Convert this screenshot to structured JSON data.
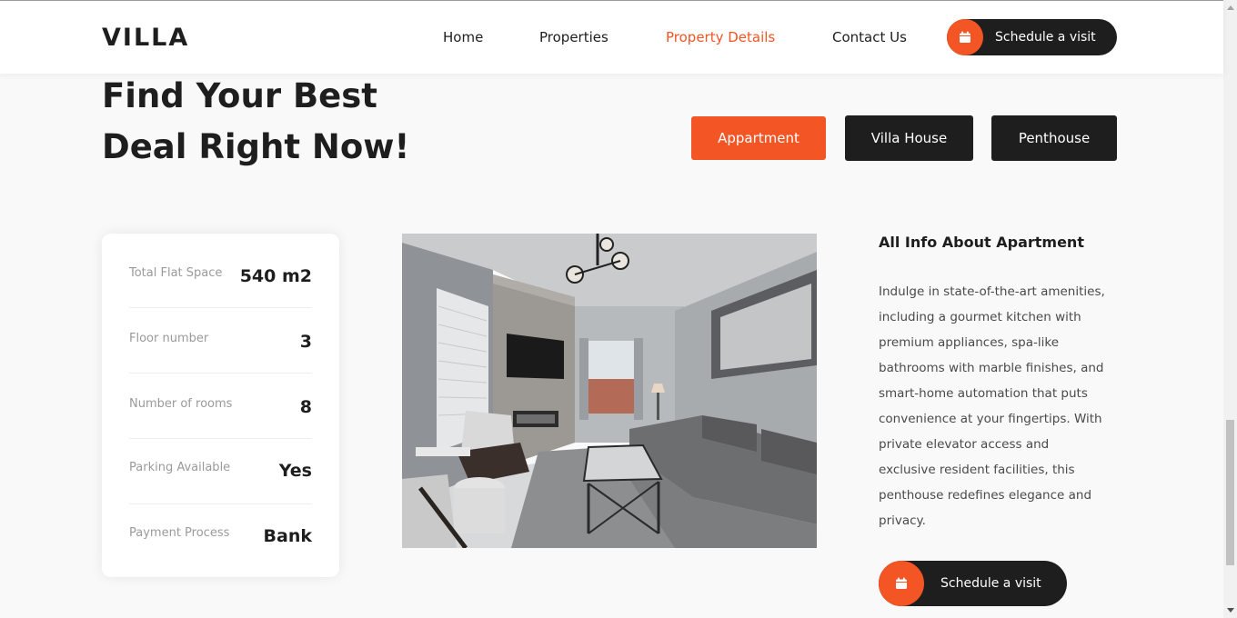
{
  "header": {
    "logo": "VILLA",
    "nav": [
      {
        "label": "Home",
        "active": false
      },
      {
        "label": "Properties",
        "active": false
      },
      {
        "label": "Property Details",
        "active": true
      },
      {
        "label": "Contact Us",
        "active": false
      }
    ],
    "cta": {
      "label": "Schedule a visit",
      "icon": "calendar-icon"
    }
  },
  "hero": {
    "title_line1": "Find Your Best",
    "title_line2": "Deal Right Now!",
    "tabs": [
      {
        "label": "Appartment",
        "active": true
      },
      {
        "label": "Villa House",
        "active": false
      },
      {
        "label": "Penthouse",
        "active": false
      }
    ]
  },
  "info": [
    {
      "label": "Total Flat Space",
      "value": "540 m2"
    },
    {
      "label": "Floor number",
      "value": "3"
    },
    {
      "label": "Number of rooms",
      "value": "8"
    },
    {
      "label": "Parking Available",
      "value": "Yes"
    },
    {
      "label": "Payment Process",
      "value": "Bank"
    }
  ],
  "about": {
    "title": "All Info About Apartment",
    "text": "Indulge in state-of-the-art amenities, including a gourmet kitchen with premium appliances, spa-like bathrooms with marble finishes, and smart-home automation that puts convenience at your fingertips. With private elevator access and exclusive resident facilities, this penthouse redefines elegance and privacy.",
    "cta": {
      "label": "Schedule a visit",
      "icon": "calendar-icon"
    }
  },
  "colors": {
    "accent": "#f35525",
    "dark": "#1e1e1e",
    "background": "#f9f9f9"
  }
}
